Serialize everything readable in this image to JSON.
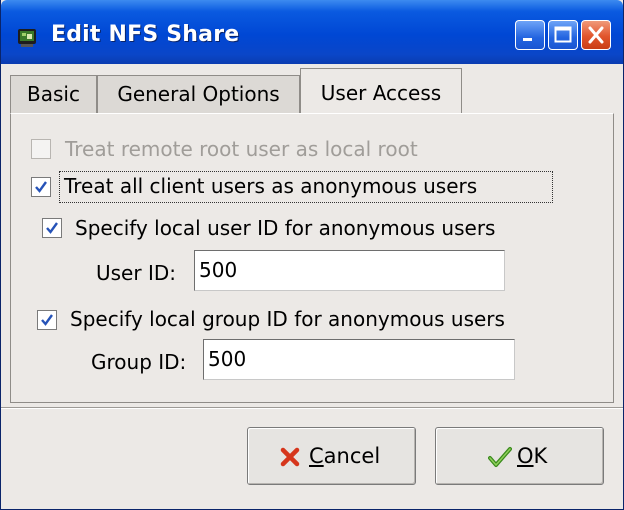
{
  "window": {
    "title": "Edit NFS Share"
  },
  "tabs": [
    {
      "label": "Basic",
      "active": false
    },
    {
      "label": "General Options",
      "active": false
    },
    {
      "label": "User Access",
      "active": true
    }
  ],
  "options": {
    "treat_root": {
      "label": "Treat remote root user as local root",
      "checked": false,
      "enabled": false
    },
    "treat_anonymous": {
      "label": "Treat all client users as anonymous users",
      "checked": true,
      "enabled": true
    },
    "specify_uid": {
      "label": "Specify local user ID for anonymous users",
      "checked": true,
      "enabled": true
    },
    "specify_gid": {
      "label": "Specify local group ID for anonymous users",
      "checked": true,
      "enabled": true
    }
  },
  "fields": {
    "user_id": {
      "label": "User ID:",
      "value": "500"
    },
    "group_id": {
      "label": "Group ID:",
      "value": "500"
    }
  },
  "buttons": {
    "cancel": {
      "label_mnemonic": "C",
      "label_rest": "ancel",
      "icon": "cancel-x-icon"
    },
    "ok": {
      "label_mnemonic": "O",
      "label_rest": "K",
      "icon": "ok-check-icon"
    }
  },
  "colors": {
    "titlebar": "#0047d4",
    "cancel_icon": "#d6361c",
    "ok_icon": "#3a8a1c",
    "check": "#2653b8"
  }
}
